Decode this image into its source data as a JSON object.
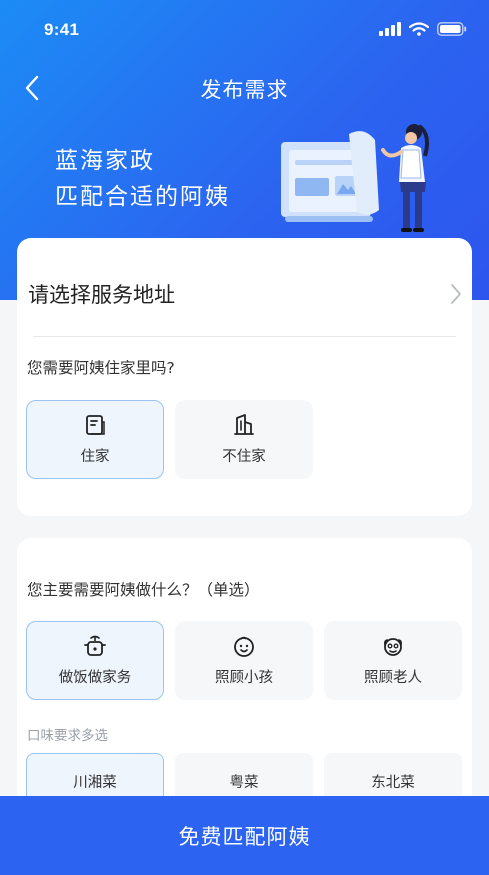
{
  "status_bar": {
    "time": "9:41"
  },
  "nav": {
    "title": "发布需求"
  },
  "banner": {
    "line1": "蓝海家政",
    "line2": "匹配合适的阿姨"
  },
  "address": {
    "label": "请选择服务地址"
  },
  "live_in": {
    "question": "您需要阿姨住家里吗?",
    "options": [
      {
        "label": "住家",
        "icon": "document-icon",
        "selected": true
      },
      {
        "label": "不住家",
        "icon": "building-icon",
        "selected": false
      }
    ]
  },
  "service": {
    "question": "您主要需要阿姨做什么？（单选）",
    "options": [
      {
        "label": "做饭做家务",
        "icon": "cooking-pot-icon",
        "selected": true
      },
      {
        "label": "照顾小孩",
        "icon": "baby-face-icon",
        "selected": false
      },
      {
        "label": "照顾老人",
        "icon": "elder-face-icon",
        "selected": false
      }
    ],
    "taste_label": "口味要求多选",
    "tastes": [
      {
        "label": "川湘菜",
        "selected": true
      },
      {
        "label": "粤菜",
        "selected": false
      },
      {
        "label": "东北菜",
        "selected": false
      }
    ]
  },
  "submit": {
    "label": "免费匹配阿姨"
  },
  "colors": {
    "primary": "#2c63f0",
    "selected_bg": "#eef5fd",
    "selected_border": "#9bc3f3"
  }
}
